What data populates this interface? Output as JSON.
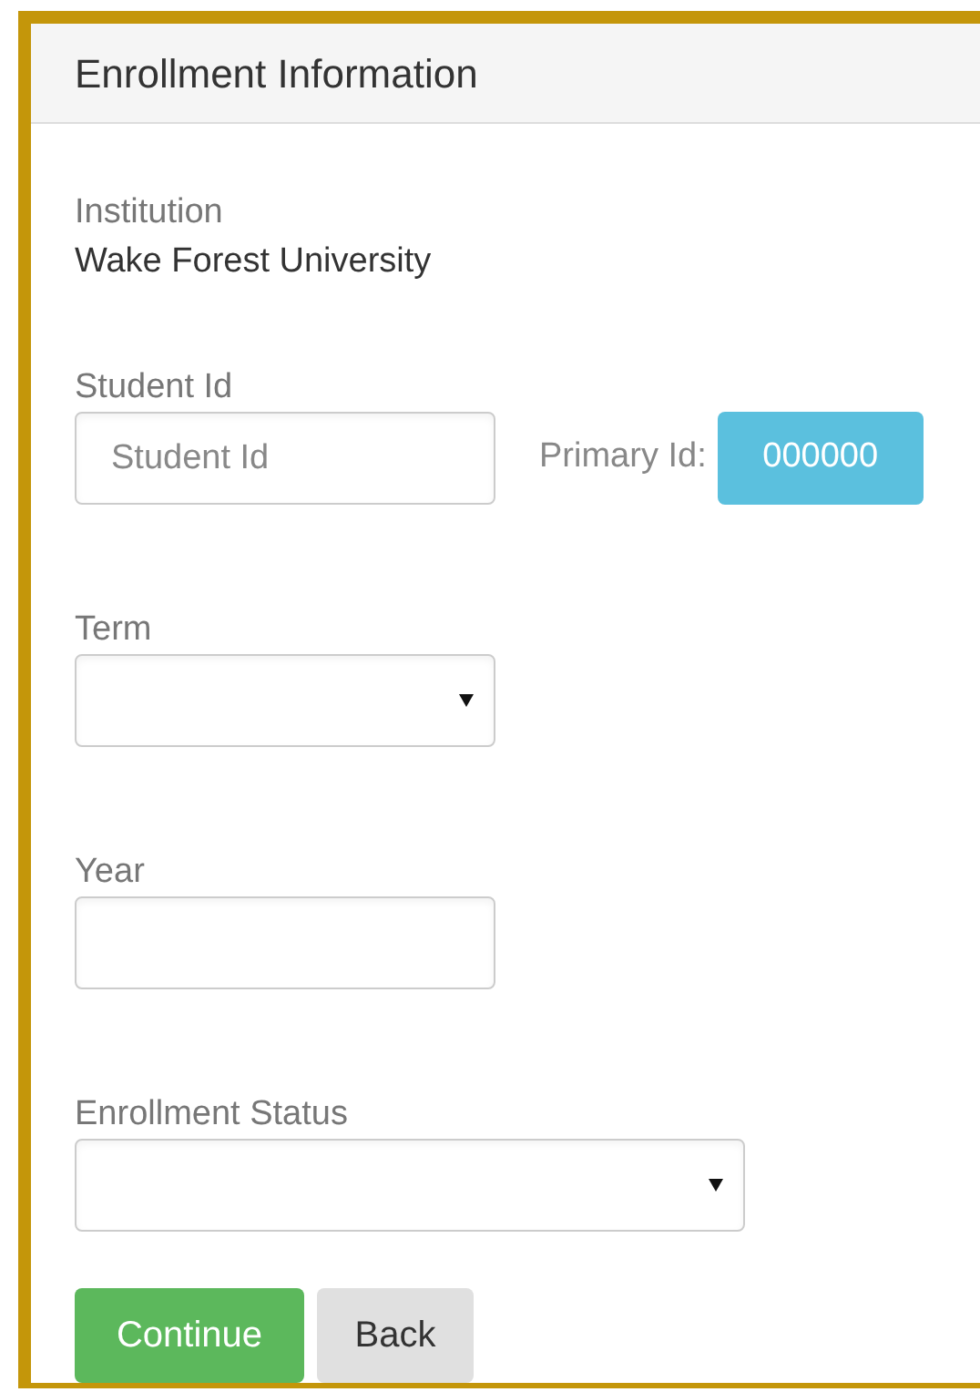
{
  "panel": {
    "title": "Enrollment Information"
  },
  "institution": {
    "label": "Institution",
    "value": "Wake Forest University"
  },
  "student_id": {
    "label": "Student Id",
    "placeholder": "Student Id",
    "primary_label": "Primary Id:",
    "primary_value": "000000"
  },
  "fields": [
    {
      "label": "Term",
      "kind": "select",
      "wide": false
    },
    {
      "label": "Year",
      "kind": "text",
      "wide": false
    },
    {
      "label": "Enrollment Status",
      "kind": "select",
      "wide": true
    }
  ],
  "buttons": [
    {
      "label": "Continue",
      "kind": "primary"
    },
    {
      "label": "Back",
      "kind": "secondary"
    }
  ]
}
